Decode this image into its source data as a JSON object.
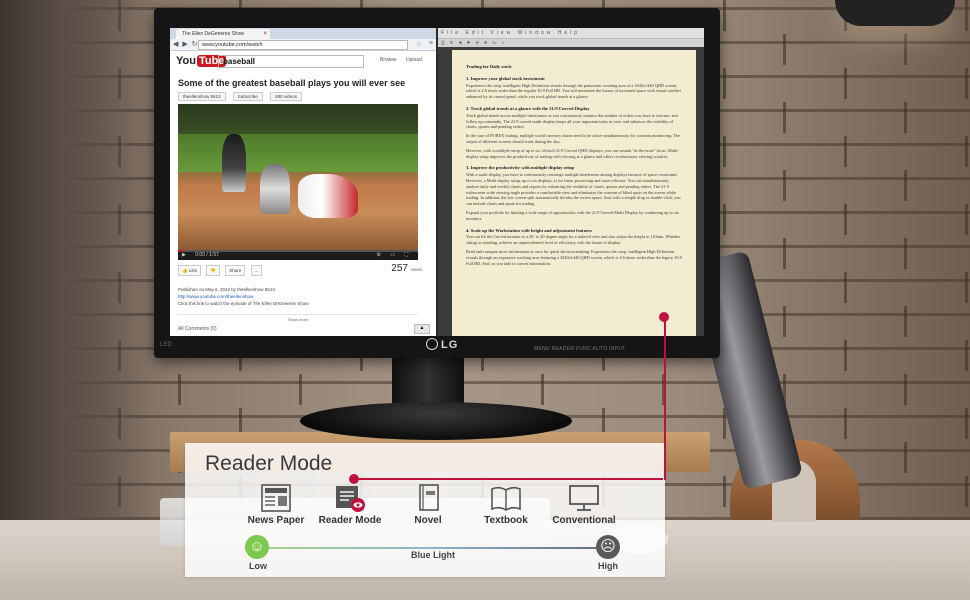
{
  "browser": {
    "tab_title": "The Ellen DeGeneres Show",
    "url": "www.youtube.com/watch",
    "youtube": {
      "logo_text": "You",
      "logo_tube": "Tube",
      "search_query": "baseball",
      "browse_label": "Browse",
      "upload_label": "Upload",
      "video_title": "Some of the greatest baseball plays you will ever see",
      "subscribe_label": "Subscribe",
      "channel_label": "theellenshow 8613",
      "videos_label": "580 videos",
      "player_time": "0:00 / 1:57",
      "like_label": "Like",
      "share_label": "Share",
      "more_label": "...",
      "view_count": "257",
      "views_word": "views",
      "published": "Published on May 6, 2012 by theellenshow 8613",
      "description_link": "http://www.youtube.com/theellenshow",
      "description_text": "Click this link to watch the episode of The Ellen DeGeneres Show",
      "show_more": "Show more",
      "comments_label": "All Comments (0)"
    }
  },
  "reader": {
    "toolbar_items": "File  Edit  View  Window  Help",
    "doc_title": "Trading for Daily stock",
    "sections": [
      {
        "head": "1. Improve your global stock investment",
        "body": "Experience the crisp, intelligent High Definition visuals through the panoramic working area of a 3440x1440 QHD screen, which is 2.6 times wider than the regular 16:9 Full HD. You will maximize the luxury of increased space with visual comfort enhanced by its curved panel, while you track global trends at a glance."
      },
      {
        "head": "2. Track global trends at a glance with the 21:9 Curved Display",
        "body": "Track global trends across multiple timeframes as you continuously monitor the number of orders you have to execute, and follow up constantly. The 21:9 curved multi-display keeps all your important tasks in view and enhances the visibility of charts, quotes and pending orders."
      },
      {
        "head": "",
        "body": "In the case of FOREX trading, multiple world currency charts need to be active simultaneously for constant monitoring. The output of different screens should work during the day."
      },
      {
        "head": "",
        "body": "However, with a multiple setup of up to six 34-inch 21:9 Curved QHD displays, you can sustain \"in-the-zone\" focus. Multi-display setup improves the productivity of trading with viewing at a glance and offers revolutionary viewing comfort."
      },
      {
        "head": "3. Improve the productivity with multiple display setup",
        "body": "With a multi display, you have to continuously rearrange multiple timeframes among displays because of space constraints. However, a Multi display setup, up to six displays, is for faster processing and more efficient. You can simultaneously analyze daily and weekly charts and reports by enhancing the visibility of charts, quotes and pending orders. The 21:9 widescreen wide viewing angle provides a comfortable view and eliminates the concern of blind spots on the screen while trading. In addition, the low screen split automatically divides the screen space. And, with a simple drag or double-click, you can include charts and quote for trading."
      },
      {
        "head": "",
        "body": "Expand your portfolio by limiting a wide range of opportunities with the 21:9 Curved Multi Display by combining up to six monitors."
      },
      {
        "head": "4. Scale up the Workstation with height and adjustment features",
        "body": "You can tilt the Curved monitor to a 20- to 20 degree angle for a tailored view and also adjust the height to 110mm. Whether sitting or standing, achieve an unprecedented level of efficiency with the future of display."
      },
      {
        "head": "",
        "body": "Read and compare more information at once for quick decision-making. Experience the crisp, intelligent High Definition visuals through an expansive working area featuring a 3440x1440 QHD screen, which is 2.6 times wider than the legacy 16:9 Full HD. And, as you fade in curved information."
      }
    ]
  },
  "monitor": {
    "brand": "LG",
    "led_label": "LED",
    "buttons_label": "MENU  READER  FUNC  AUTO  INPUT"
  },
  "overlay": {
    "title": "Reader Mode",
    "modes": [
      {
        "label": "News Paper",
        "icon": "newspaper-icon"
      },
      {
        "label": "Reader Mode",
        "icon": "reader-mode-icon"
      },
      {
        "label": "Novel",
        "icon": "book-icon"
      },
      {
        "label": "Textbook",
        "icon": "open-book-icon"
      },
      {
        "label": "Conventional",
        "icon": "monitor-icon"
      }
    ],
    "scale_low": "Low",
    "scale_middle": "Blue Light",
    "scale_high": "High",
    "accent_color": "#c1103c",
    "low_color": "#7cc94e",
    "high_color": "#5a5a5a"
  }
}
